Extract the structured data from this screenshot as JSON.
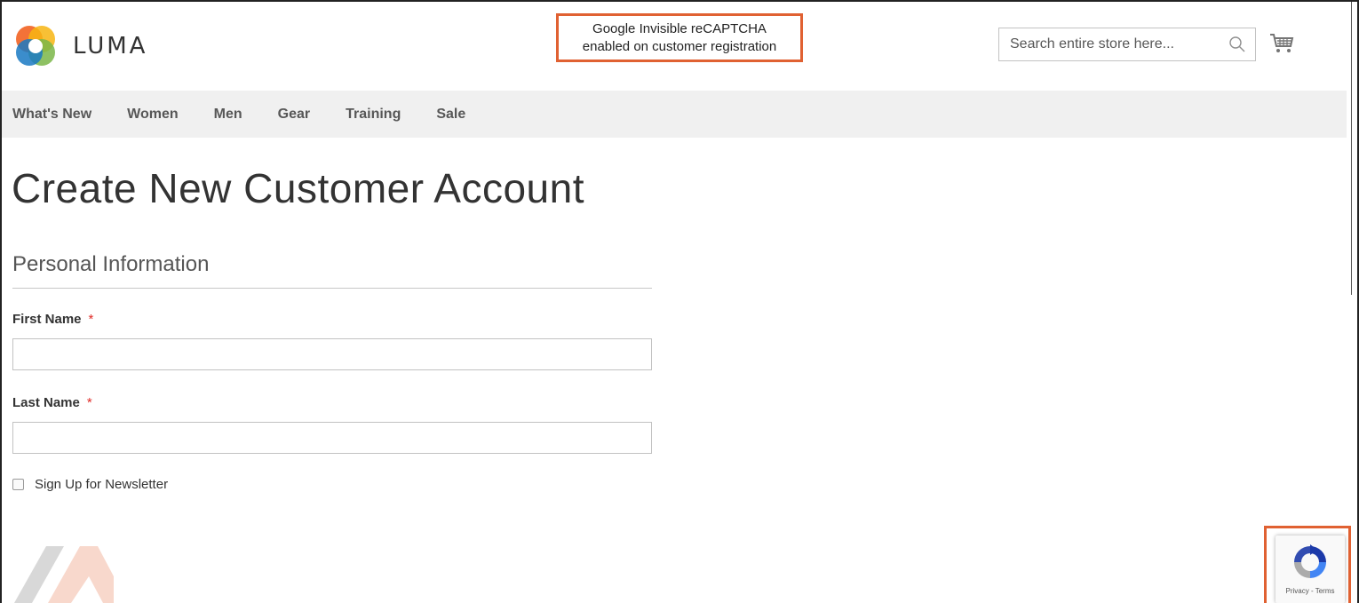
{
  "header": {
    "logo_text": "LUMA",
    "annotation_line1": "Google Invisible reCAPTCHA",
    "annotation_line2": "enabled on  customer registration",
    "search_placeholder": "Search entire store here...",
    "icons": {
      "search": "search-icon",
      "cart": "cart-icon"
    }
  },
  "nav": {
    "items": [
      {
        "label": "What's New"
      },
      {
        "label": "Women"
      },
      {
        "label": "Men"
      },
      {
        "label": "Gear"
      },
      {
        "label": "Training"
      },
      {
        "label": "Sale"
      }
    ]
  },
  "main": {
    "title": "Create New Customer Account",
    "section_title": "Personal Information",
    "first_name": {
      "label": "First Name",
      "required_mark": "*",
      "value": ""
    },
    "last_name": {
      "label": "Last Name",
      "required_mark": "*",
      "value": ""
    },
    "newsletter_label": "Sign Up for Newsletter",
    "newsletter_checked": false
  },
  "recaptcha": {
    "links": "Privacy - Terms"
  },
  "colors": {
    "highlight": "#e06132",
    "nav_bg": "#f0f0f0",
    "required": "#e02b27"
  }
}
